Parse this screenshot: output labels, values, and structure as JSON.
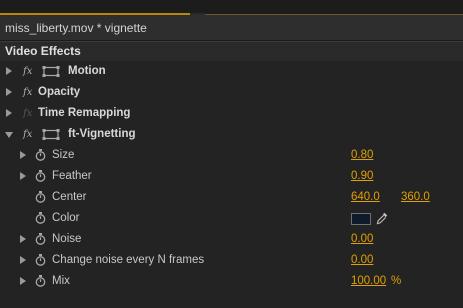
{
  "clip": {
    "title": "miss_liberty.mov * vignette"
  },
  "panel": {
    "section_title": "Video Effects"
  },
  "effects": [
    {
      "name": "Motion",
      "fx_enabled": true
    },
    {
      "name": "Opacity",
      "fx_enabled": true
    },
    {
      "name": "Time Remapping",
      "fx_enabled": false
    },
    {
      "name": "ft-Vignetting",
      "fx_enabled": true
    }
  ],
  "fx_glyph": "fx",
  "vignette_params": {
    "size": {
      "label": "Size",
      "value": "0.80"
    },
    "feather": {
      "label": "Feather",
      "value": "0.90"
    },
    "center": {
      "label": "Center",
      "x": "640.0",
      "y": "360.0"
    },
    "color": {
      "label": "Color",
      "swatch": "#0f1a2a"
    },
    "noise": {
      "label": "Noise",
      "value": "0.00"
    },
    "change_noise": {
      "label": "Change noise every N frames",
      "value": "0.00"
    },
    "mix": {
      "label": "Mix",
      "value": "100.00",
      "unit": "%"
    }
  },
  "colors": {
    "value_accent": "#e0a000",
    "background": "#232323"
  }
}
